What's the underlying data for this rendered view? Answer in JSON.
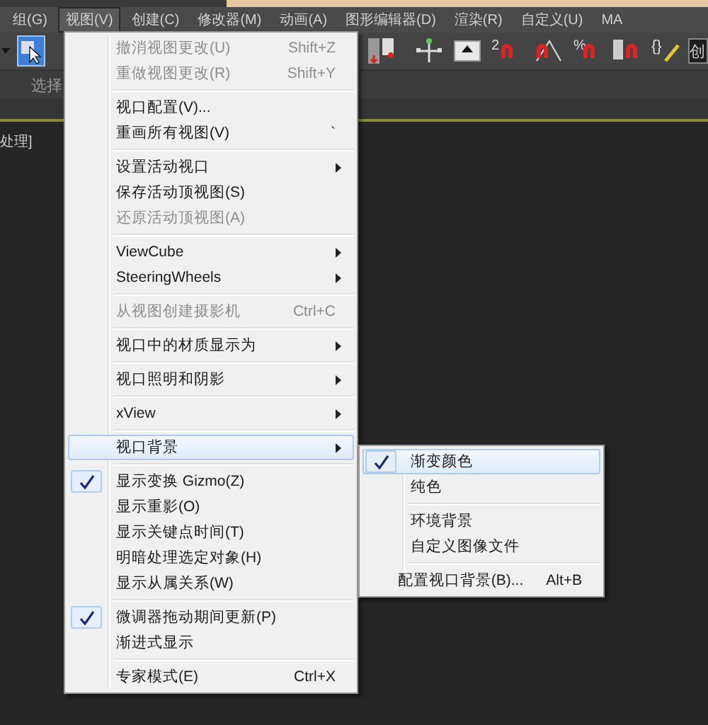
{
  "menubar": [
    {
      "label": "组(G)",
      "selected": false
    },
    {
      "label": "视图(V)",
      "selected": true
    },
    {
      "label": "创建(C)",
      "selected": false
    },
    {
      "label": "修改器(M)",
      "selected": false
    },
    {
      "label": "动画(A)",
      "selected": false
    },
    {
      "label": "图形编辑器(D)",
      "selected": false
    },
    {
      "label": "渲染(R)",
      "selected": false
    },
    {
      "label": "自定义(U)",
      "selected": false
    },
    {
      "label": "MA",
      "selected": false
    }
  ],
  "toolbar": {
    "snap_text": "2",
    "percent_snap_text": "%",
    "named_selection_text": "{}",
    "field_value": "创"
  },
  "ribbon_tab": "选择",
  "viewport": {
    "label": "处理]"
  },
  "menu": [
    {
      "kind": "item",
      "label": "撤消视图更改(U)",
      "shortcut": "Shift+Z",
      "disabled": true,
      "checked": false,
      "submenu": false,
      "highlighted": false
    },
    {
      "kind": "item",
      "label": "重做视图更改(R)",
      "shortcut": "Shift+Y",
      "disabled": true,
      "checked": false,
      "submenu": false,
      "highlighted": false
    },
    {
      "kind": "separator"
    },
    {
      "kind": "item",
      "label": "视口配置(V)...",
      "disabled": false,
      "checked": false,
      "submenu": false,
      "highlighted": false
    },
    {
      "kind": "item",
      "label": "重画所有视图(V)",
      "shortcut": "`",
      "disabled": false,
      "checked": false,
      "submenu": false,
      "highlighted": false
    },
    {
      "kind": "separator"
    },
    {
      "kind": "item",
      "label": "设置活动视口",
      "disabled": false,
      "checked": false,
      "submenu": true,
      "highlighted": false
    },
    {
      "kind": "item",
      "label": "保存活动顶视图(S)",
      "disabled": false,
      "checked": false,
      "submenu": false,
      "highlighted": false
    },
    {
      "kind": "item",
      "label": "还原活动顶视图(A)",
      "disabled": true,
      "checked": false,
      "submenu": false,
      "highlighted": false
    },
    {
      "kind": "separator"
    },
    {
      "kind": "item",
      "label": "ViewCube",
      "disabled": false,
      "checked": false,
      "submenu": true,
      "highlighted": false
    },
    {
      "kind": "item",
      "label": "SteeringWheels",
      "disabled": false,
      "checked": false,
      "submenu": true,
      "highlighted": false
    },
    {
      "kind": "separator"
    },
    {
      "kind": "item",
      "label": "从视图创建摄影机",
      "shortcut": "Ctrl+C",
      "disabled": true,
      "checked": false,
      "submenu": false,
      "highlighted": false
    },
    {
      "kind": "separator"
    },
    {
      "kind": "item",
      "label": "视口中的材质显示为",
      "disabled": false,
      "checked": false,
      "submenu": true,
      "highlighted": false
    },
    {
      "kind": "separator"
    },
    {
      "kind": "item",
      "label": "视口照明和阴影",
      "disabled": false,
      "checked": false,
      "submenu": true,
      "highlighted": false
    },
    {
      "kind": "separator"
    },
    {
      "kind": "item",
      "label": "xView",
      "disabled": false,
      "checked": false,
      "submenu": true,
      "highlighted": false
    },
    {
      "kind": "separator"
    },
    {
      "kind": "item",
      "label": "视口背景",
      "disabled": false,
      "checked": false,
      "submenu": true,
      "highlighted": true
    },
    {
      "kind": "separator"
    },
    {
      "kind": "item",
      "label": "显示变换 Gizmo(Z)",
      "disabled": false,
      "checked": true,
      "submenu": false,
      "highlighted": false
    },
    {
      "kind": "item",
      "label": "显示重影(O)",
      "disabled": false,
      "checked": false,
      "submenu": false,
      "highlighted": false
    },
    {
      "kind": "item",
      "label": "显示关键点时间(T)",
      "disabled": false,
      "checked": false,
      "submenu": false,
      "highlighted": false
    },
    {
      "kind": "item",
      "label": "明暗处理选定对象(H)",
      "disabled": false,
      "checked": false,
      "submenu": false,
      "highlighted": false
    },
    {
      "kind": "item",
      "label": "显示从属关系(W)",
      "disabled": false,
      "checked": false,
      "submenu": false,
      "highlighted": false
    },
    {
      "kind": "separator"
    },
    {
      "kind": "item",
      "label": "微调器拖动期间更新(P)",
      "disabled": false,
      "checked": true,
      "submenu": false,
      "highlighted": false
    },
    {
      "kind": "item",
      "label": "渐进式显示",
      "disabled": false,
      "checked": false,
      "submenu": false,
      "highlighted": false
    },
    {
      "kind": "separator"
    },
    {
      "kind": "item",
      "label": "专家模式(E)",
      "shortcut": "Ctrl+X",
      "disabled": false,
      "checked": false,
      "submenu": false,
      "highlighted": false
    }
  ],
  "submenu": [
    {
      "kind": "item",
      "label": "渐变颜色",
      "disabled": false,
      "checked": true,
      "submenu": false,
      "highlighted": true
    },
    {
      "kind": "item",
      "label": "纯色",
      "disabled": false,
      "checked": false,
      "submenu": false,
      "highlighted": false
    },
    {
      "kind": "separator"
    },
    {
      "kind": "item",
      "label": "环境背景",
      "disabled": false,
      "checked": false,
      "submenu": false,
      "highlighted": false
    },
    {
      "kind": "item",
      "label": "自定义图像文件",
      "disabled": false,
      "checked": false,
      "submenu": false,
      "highlighted": false
    },
    {
      "kind": "separator"
    },
    {
      "kind": "item",
      "label": "配置视口背景(B)...",
      "shortcut": "Alt+B",
      "disabled": false,
      "checked": false,
      "submenu": false,
      "highlighted": false
    }
  ]
}
